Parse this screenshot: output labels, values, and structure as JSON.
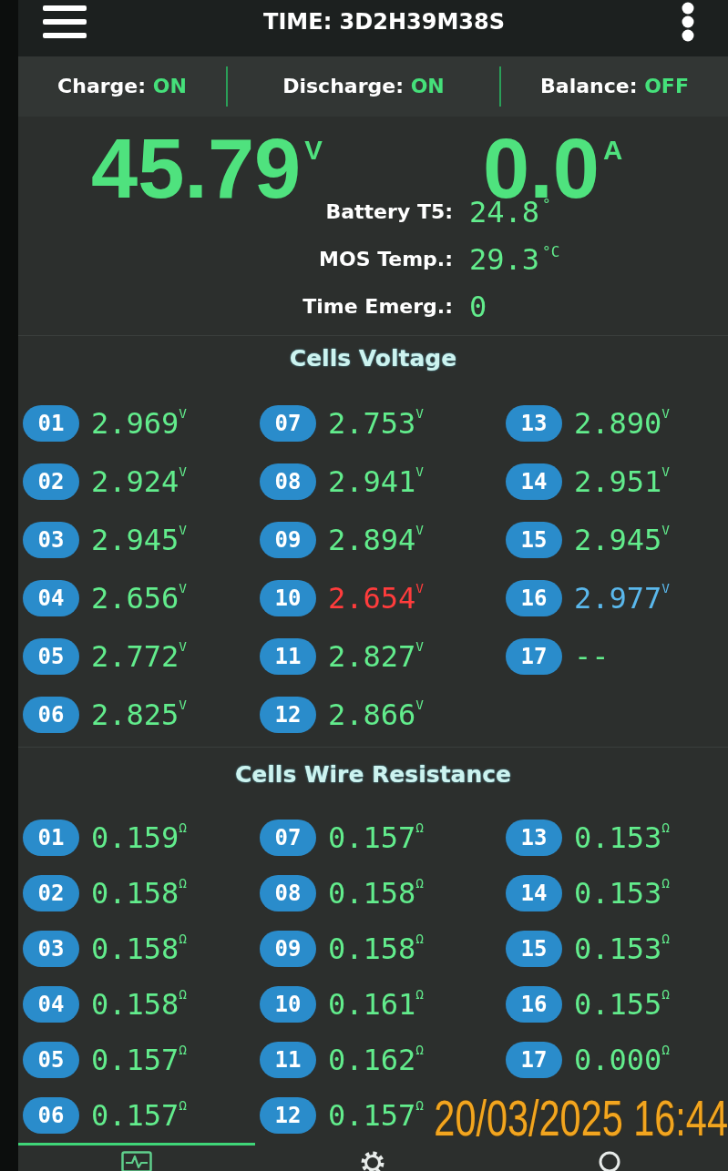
{
  "header": {
    "title": "TIME: 3D2H39M38S"
  },
  "status": [
    {
      "label": "Charge:",
      "value": "ON"
    },
    {
      "label": "Discharge:",
      "value": "ON"
    },
    {
      "label": "Balance:",
      "value": "OFF"
    }
  ],
  "main_readings": {
    "voltage": "45.79$^{V}$",
    "current": "0.0$^{A}$"
  },
  "details": [
    {
      "label": "Battery T5:",
      "value": "24.8$^{°}$"
    },
    {
      "label": "MOS Temp.:",
      "value": "29.3$^{°C}$"
    },
    {
      "label": "Time Emerg.:",
      "value": "0"
    }
  ],
  "cells_voltage": {
    "title": "Cells Voltage",
    "cells": [
      {
        "number": "01",
        "value": "2.969$^{V}$",
        "color": "#62ec8c"
      },
      {
        "number": "02",
        "value": "2.924$^{V}$",
        "color": "#62ec8c"
      },
      {
        "number": "03",
        "value": "2.945$^{V}$",
        "color": "#62ec8c"
      },
      {
        "number": "04",
        "value": "2.656$^{V}$",
        "color": "#62ec8c"
      },
      {
        "number": "05",
        "value": "2.772$^{V}$",
        "color": "#62ec8c"
      },
      {
        "number": "06",
        "value": "2.825$^{V}$",
        "color": "#62ec8c"
      },
      {
        "number": "07",
        "value": "2.753$^{V}$",
        "color": "#62ec8c"
      },
      {
        "number": "08",
        "value": "2.941$^{V}$",
        "color": "#62ec8c"
      },
      {
        "number": "09",
        "value": "2.894$^{V}$",
        "color": "#62ec8c"
      },
      {
        "number": "10",
        "value": "2.654$^{V}$",
        "color": "#ff3c3c"
      },
      {
        "number": "11",
        "value": "2.827$^{V}$",
        "color": "#62ec8c"
      },
      {
        "number": "12",
        "value": "2.866$^{V}$",
        "color": "#62ec8c"
      },
      {
        "number": "13",
        "value": "2.890$^{V}$",
        "color": "#62ec8c"
      },
      {
        "number": "14",
        "value": "2.951$^{V}$",
        "color": "#62ec8c"
      },
      {
        "number": "15",
        "value": "2.945$^{V}$",
        "color": "#62ec8c"
      },
      {
        "number": "16",
        "value": "2.977$^{V}$",
        "color": "#5ab8ec"
      },
      {
        "number": "17",
        "value": "--",
        "color": "#62ec8c"
      }
    ]
  },
  "cells_wire_resistance": {
    "title": "Cells Wire Resistance",
    "cells": [
      {
        "number": "01",
        "value": "0.159$^{Ω}$"
      },
      {
        "number": "02",
        "value": "0.158$^{Ω}$"
      },
      {
        "number": "03",
        "value": "0.158$^{Ω}$"
      },
      {
        "number": "04",
        "value": "0.158$^{Ω}$"
      },
      {
        "number": "05",
        "value": "0.157$^{Ω}$"
      },
      {
        "number": "06",
        "value": "0.157$^{Ω}$"
      },
      {
        "number": "07",
        "value": "0.157$^{Ω}$"
      },
      {
        "number": "08",
        "value": "0.158$^{Ω}$"
      },
      {
        "number": "09",
        "value": "0.158$^{Ω}$"
      },
      {
        "number": "10",
        "value": "0.161$^{Ω}$"
      },
      {
        "number": "11",
        "value": "0.162$^{Ω}$"
      },
      {
        "number": "12",
        "value": "0.157$^{Ω}$"
      },
      {
        "number": "13",
        "value": "0.153$^{Ω}$"
      },
      {
        "number": "14",
        "value": "0.153$^{Ω}$"
      },
      {
        "number": "15",
        "value": "0.153$^{Ω}$"
      },
      {
        "number": "16",
        "value": "0.155$^{Ω}$"
      },
      {
        "number": "17",
        "value": "0.000$^{Ω}$"
      }
    ]
  },
  "bottom_nav": [
    {
      "selected": true
    },
    {
      "selected": false
    },
    {
      "selected": false
    }
  ],
  "camera_timestamp": "20/03/2025 16:44"
}
